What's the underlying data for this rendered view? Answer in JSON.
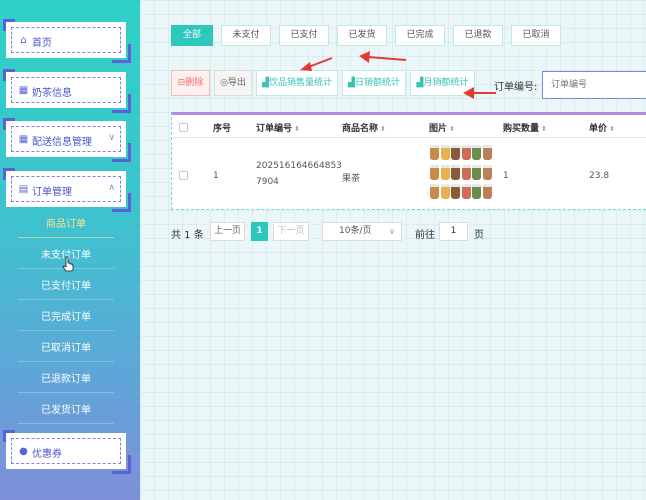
{
  "sidebar": {
    "menus": [
      {
        "label": "首页",
        "icon": "home-icon",
        "chevron": ""
      },
      {
        "label": "奶茶信息",
        "icon": "grid-icon",
        "chevron": ""
      },
      {
        "label": "配送信息管理",
        "icon": "grid-icon",
        "chevron": "∨"
      },
      {
        "label": "订单管理",
        "icon": "cart-icon",
        "chevron": "∧"
      },
      {
        "label": "优惠券",
        "icon": "drop-icon",
        "chevron": ""
      }
    ],
    "sub_items": [
      "商品订单",
      "未支付订单",
      "已支付订单",
      "已完成订单",
      "已取消订单",
      "已退款订单",
      "已发货订单"
    ],
    "active_sub": "商品订单"
  },
  "tabs": [
    "全部",
    "未支付",
    "已支付",
    "已发货",
    "已完成",
    "已退款",
    "已取消"
  ],
  "active_tab": "全部",
  "toolbar": {
    "delete": "⊟删除",
    "export": "◎导出",
    "stat_sales": "▟饮品销售量统计",
    "stat_daily": "▟日销额统计",
    "stat_monthly": "▟月销额统计"
  },
  "search": {
    "label": "订单编号:",
    "placeholder": "订单编号"
  },
  "table": {
    "headers": [
      "序号",
      "订单编号",
      "商品名称",
      "图片",
      "购买数量",
      "单价"
    ],
    "rows": [
      {
        "index": "1",
        "order_no_line1": "202516164664853",
        "order_no_line2": "7904",
        "product": "果茶",
        "qty": "1",
        "price": "23.8"
      }
    ]
  },
  "pagination": {
    "total": "共 1 条",
    "prev": "上一页",
    "current": "1",
    "next": "下一页",
    "page_size": "10条/页",
    "goto": "前往",
    "goto_value": "1",
    "page_suffix": "页"
  },
  "colors": {
    "accent": "#2ec7bb",
    "menu_border": "#5a63d6",
    "annotation_arrow": "#e53935",
    "header_bar": "#b58be0"
  }
}
